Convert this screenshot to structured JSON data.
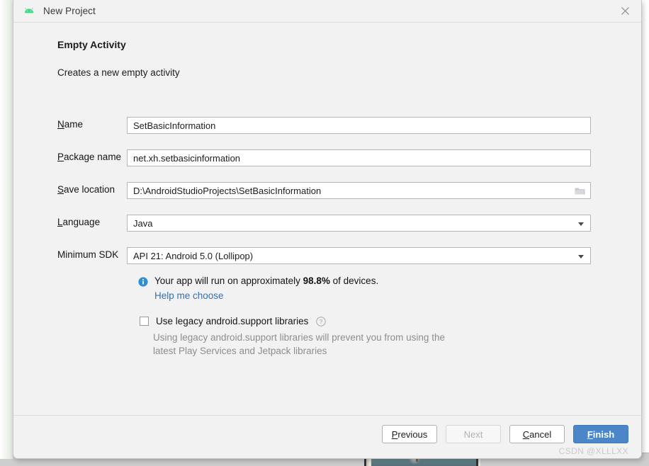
{
  "window": {
    "title": "New Project",
    "app_icon": "android-robot-icon",
    "close_icon": "close-icon"
  },
  "header": {
    "heading": "Empty Activity",
    "subheading": "Creates a new empty activity"
  },
  "form": {
    "fields": [
      {
        "label_prefix": "",
        "mnemonic": "N",
        "label_suffix": "ame",
        "value": "SetBasicInformation",
        "type": "text",
        "name": "name"
      },
      {
        "label_prefix": "",
        "mnemonic": "P",
        "label_suffix": "ackage name",
        "value": "net.xh.setbasicinformation",
        "type": "text",
        "name": "package-name"
      },
      {
        "label_prefix": "",
        "mnemonic": "S",
        "label_suffix": "ave location",
        "value": "D:\\AndroidStudioProjects\\SetBasicInformation",
        "type": "text-with-browse",
        "name": "save-location"
      },
      {
        "label_prefix": "",
        "mnemonic": "L",
        "label_suffix": "anguage",
        "value": "Java",
        "type": "dropdown",
        "name": "language"
      },
      {
        "label_prefix": "Minimum SDK",
        "mnemonic": "",
        "label_suffix": "",
        "value": "API 21: Android 5.0 (Lollipop)",
        "type": "dropdown",
        "name": "minimum-sdk"
      }
    ]
  },
  "device_info": {
    "icon": "info-icon",
    "text_before": "Your app will run on approximately ",
    "percentage": "98.8%",
    "text_after": " of devices.",
    "help_link": "Help me choose"
  },
  "legacy": {
    "checked": false,
    "label": "Use legacy android.support libraries",
    "help_icon": "question-mark-icon",
    "description": "Using legacy android.support libraries will prevent you from using the latest Play Services and Jetpack libraries"
  },
  "footer": {
    "buttons": [
      {
        "name": "previous",
        "prefix": "",
        "mnemonic": "P",
        "suffix": "revious",
        "state": "enabled"
      },
      {
        "name": "next",
        "prefix": "Next",
        "mnemonic": "",
        "suffix": "",
        "state": "disabled"
      },
      {
        "name": "cancel",
        "prefix": "",
        "mnemonic": "C",
        "suffix": "ancel",
        "state": "enabled"
      },
      {
        "name": "finish",
        "prefix": "",
        "mnemonic": "F",
        "suffix": "inish",
        "state": "primary"
      }
    ]
  },
  "watermark": "CSDN @XLLLXX",
  "colors": {
    "accent": "#4a86c8",
    "link": "#3370b5",
    "android_green": "#3ddc84",
    "dialog_bg": "#f2f2f2"
  }
}
